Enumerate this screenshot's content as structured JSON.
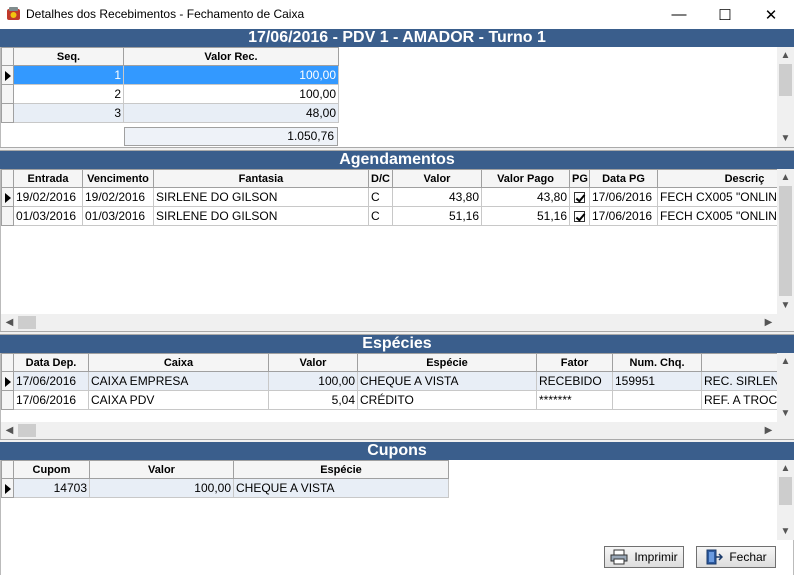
{
  "window": {
    "title": "Detalhes dos Recebimentos - Fechamento de Caixa",
    "minimize": "—",
    "maximize": "☐",
    "close": "✕"
  },
  "header": {
    "title": "17/06/2016 - PDV 1 - AMADOR - Turno 1"
  },
  "recebimentos": {
    "columns": [
      "Seq.",
      "Valor Rec."
    ],
    "rows": [
      {
        "seq": "1",
        "valor": "100,00"
      },
      {
        "seq": "2",
        "valor": "100,00"
      },
      {
        "seq": "3",
        "valor": "48,00"
      }
    ],
    "total": "1.050,76"
  },
  "agendamentos": {
    "title": "Agendamentos",
    "columns": [
      "Entrada",
      "Vencimento",
      "Fantasia",
      "D/C",
      "Valor",
      "Valor Pago",
      "PG",
      "Data PG",
      "Descriç"
    ],
    "rows": [
      {
        "entrada": "19/02/2016",
        "vencimento": "19/02/2016",
        "fantasia": "SIRLENE DO GILSON",
        "dc": "C",
        "valor": "43,80",
        "valor_pago": "43,80",
        "pg": true,
        "data_pg": "17/06/2016",
        "descricao": "FECH CX005 \"ONLIN"
      },
      {
        "entrada": "01/03/2016",
        "vencimento": "01/03/2016",
        "fantasia": "SIRLENE DO GILSON",
        "dc": "C",
        "valor": "51,16",
        "valor_pago": "51,16",
        "pg": true,
        "data_pg": "17/06/2016",
        "descricao": "FECH CX005 \"ONLIN"
      }
    ]
  },
  "especies": {
    "title": "Espécies",
    "columns": [
      "Data Dep.",
      "Caixa",
      "Valor",
      "Espécie",
      "Fator",
      "Num. Chq.",
      ""
    ],
    "rows": [
      {
        "data_dep": "17/06/2016",
        "caixa": "CAIXA EMPRESA",
        "valor": "100,00",
        "especie": "CHEQUE A VISTA",
        "fator": "RECEBIDO",
        "num_chq": "159951",
        "obs": "REC. SIRLEN"
      },
      {
        "data_dep": "17/06/2016",
        "caixa": "CAIXA PDV",
        "valor": "5,04",
        "especie": "CRÉDITO",
        "fator": "*******",
        "num_chq": "",
        "obs": "REF. A TROCO"
      }
    ]
  },
  "cupons": {
    "title": "Cupons",
    "columns": [
      "Cupom",
      "Valor",
      "Espécie"
    ],
    "rows": [
      {
        "cupom": "14703",
        "valor": "100,00",
        "especie": "CHEQUE A VISTA"
      }
    ]
  },
  "buttons": {
    "imprimir": "Imprimir",
    "fechar": "Fechar"
  }
}
